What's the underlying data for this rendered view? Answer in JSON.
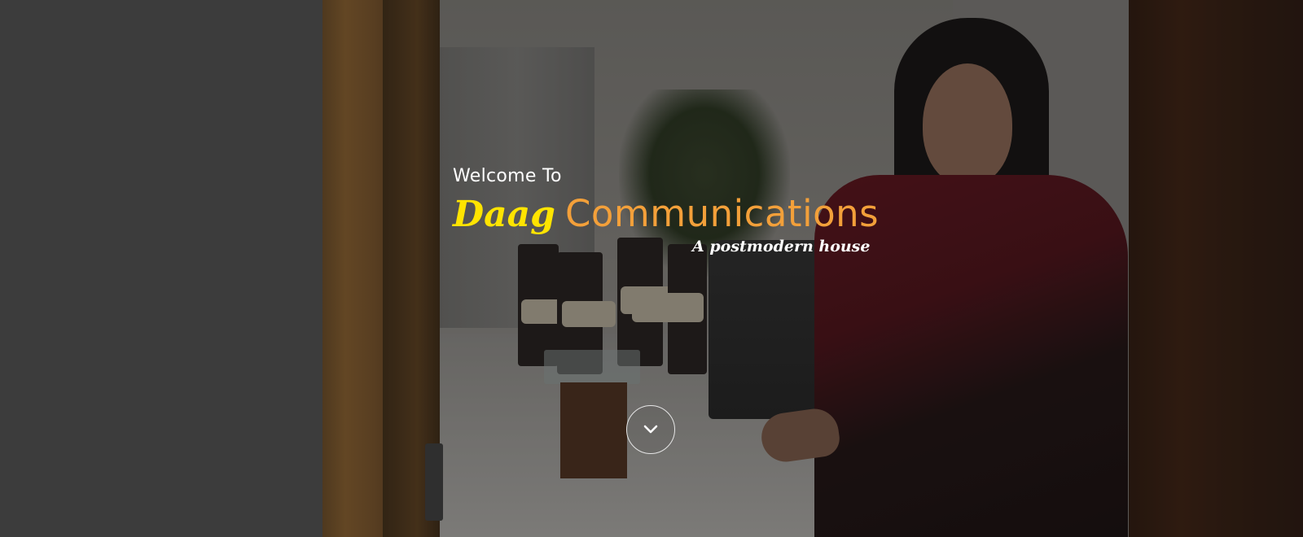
{
  "hero": {
    "welcome_text": "Welcome To",
    "brand_script": "Daag",
    "brand_name": "Communications",
    "tagline": "A postmodern house",
    "scroll_icon": "chevron-down-icon"
  },
  "colors": {
    "brand_script": "#ffe400",
    "brand_name": "#f3a03a",
    "text": "#ffffff",
    "overlay": "#2a2a2a"
  }
}
